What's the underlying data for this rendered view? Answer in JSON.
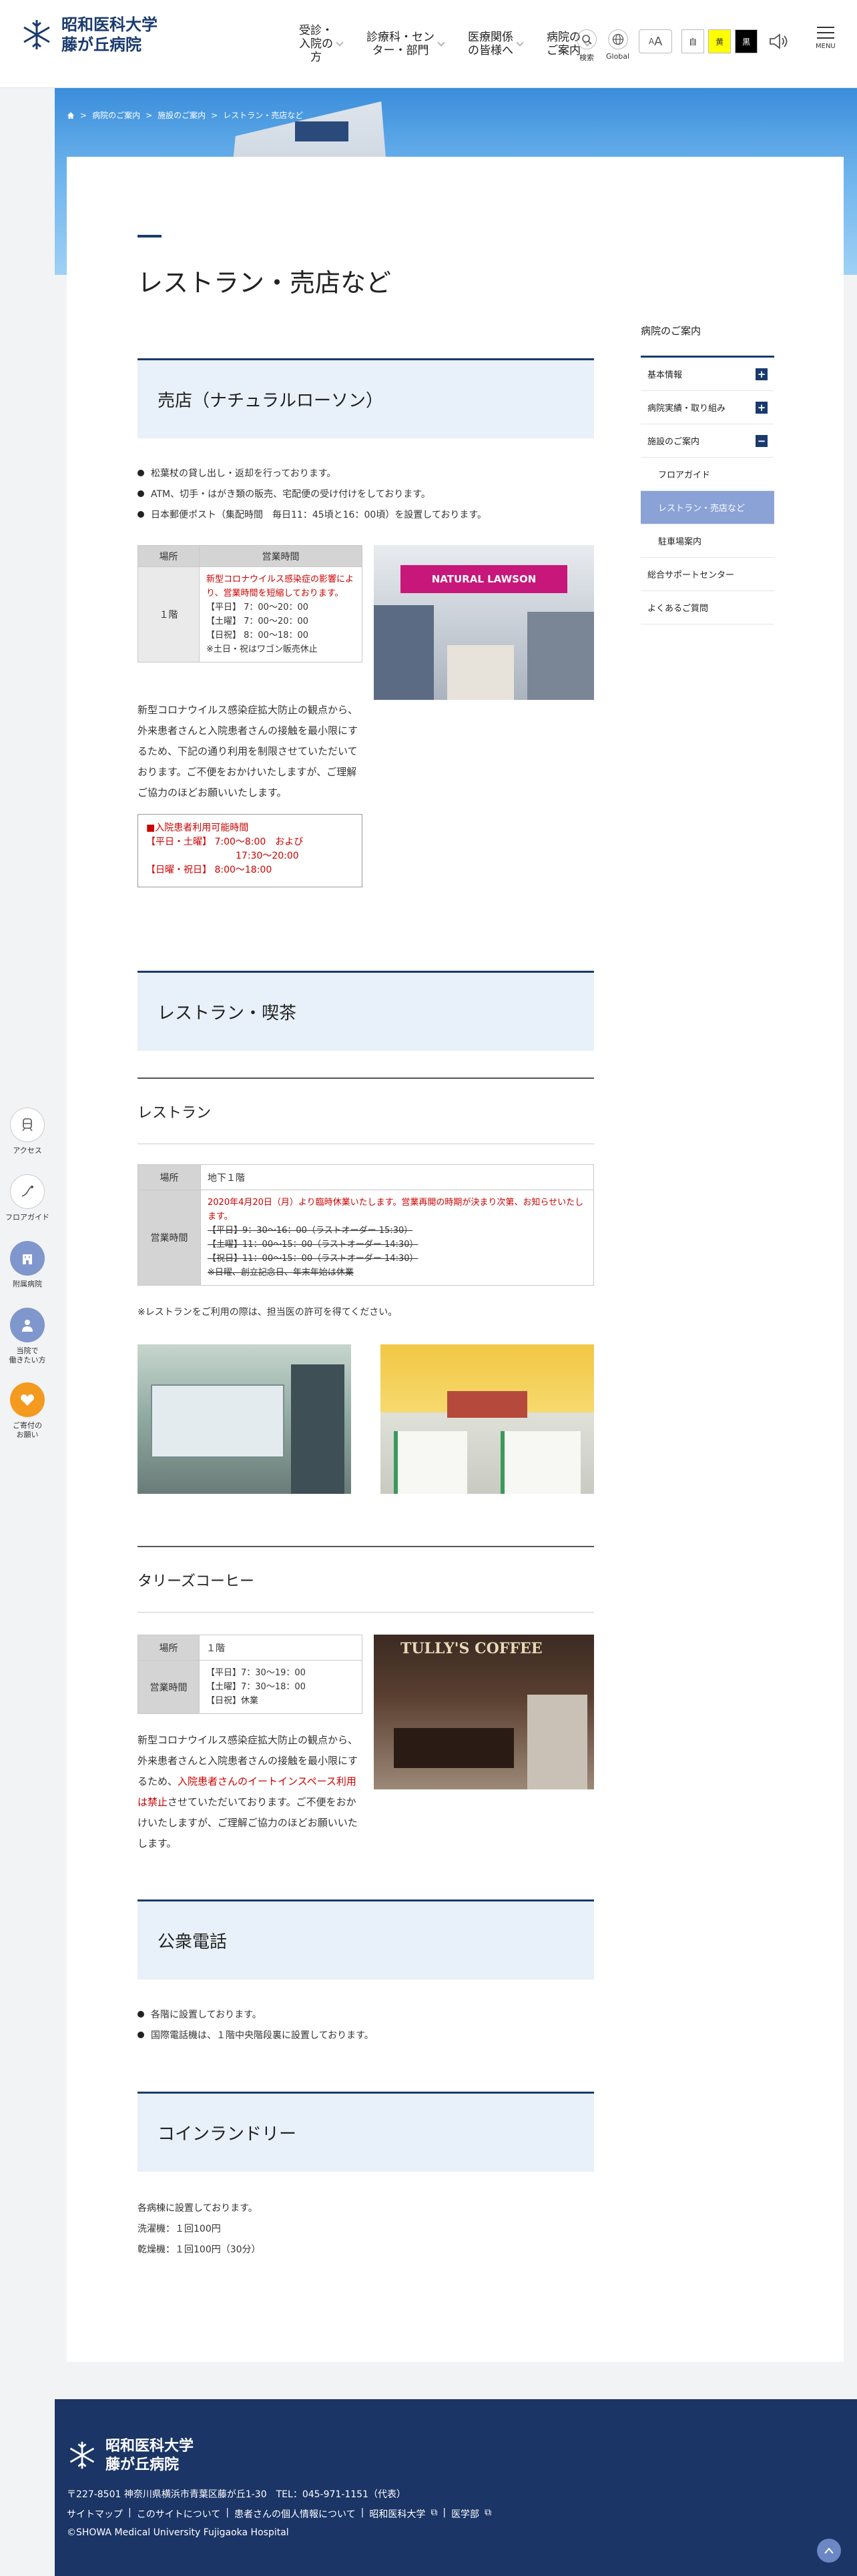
{
  "header": {
    "logo_line1": "昭和医科大学",
    "logo_line2": "藤が丘病院",
    "nav": [
      "受診・\n入院の\n方",
      "診療科・セン\nター・部門",
      "医療関係\nの皆様へ",
      "病院の\nご案内"
    ],
    "search_label": "検索",
    "global_label": "Global",
    "font_label": "A",
    "color_std": "自",
    "color_yellow": "黄",
    "color_black": "黒",
    "menu_label": "MENU"
  },
  "breadcrumb": [
    "病院のご案内",
    "施設のご案内",
    "レストラン・売店など"
  ],
  "page": {
    "title": "レストラン・売店など"
  },
  "store": {
    "heading": "売店（ナチュラルローソン）",
    "bullets": [
      "松葉杖の貸し出し・返却を行っております。",
      "ATM、切手・はがき類の販売、宅配便の受け付けをしております。",
      "日本郵便ポスト（集配時間　毎日11：45頃と16：00頃）を設置しております。"
    ],
    "th_place": "場所",
    "th_hours": "営業時間",
    "place": "１階",
    "hours_notice": "新型コロナウイルス感染症の影響により、営業時間を短縮しております。",
    "hours": [
      "【平日】 7：00〜20：00",
      "【土曜】 7：00〜20：00",
      "【日祝】 8：00〜18：00",
      "※土日・祝はワゴン販売休止"
    ],
    "photo_sign": "NATURAL LAWSON",
    "paragraph": "新型コロナウイルス感染症拡大防止の観点から、外来患者さんと入院患者さんの接触を最小限にするため、下記の通り利用を制限させていただいております。ご不便をおかけいたしますが、ご理解ご協力のほどお願いいたします。",
    "notice_title": "■入院患者利用可能時間",
    "notice_lines": [
      "【平日・土曜】 7:00〜8:00　および",
      "17:30〜20:00",
      "【日曜・祝日】 8:00〜18:00"
    ]
  },
  "restaurant": {
    "heading": "レストラン・喫茶",
    "sub1": "レストラン",
    "th_place": "場所",
    "place": "地下１階",
    "th_hours": "営業時間",
    "notice": "2020年4月20日（月）より臨時休業いたします。営業再開の時期が決まり次第、お知らせいたします。",
    "old_hours": [
      "【平日】9：30〜16：00（ラストオーダー 15:30）",
      "【土曜】11：00〜15：00（ラストオーダー 14:30）",
      "【祝日】11：00〜15：00（ラストオーダー 14:30）",
      "※日曜、創立記念日、年末年始は休業"
    ],
    "note": "※レストランをご利用の際は、担当医の許可を得てください。",
    "sub2": "タリーズコーヒー",
    "t_place": "１階",
    "t_hours": [
      "【平日】7：30〜19：00",
      "【土曜】7：30〜18：00",
      "【日祝】休業"
    ],
    "th_hours2": "営業時間",
    "tully_sign": "TULLY'S COFFEE",
    "tully_para_1": "新型コロナウイルス感染症拡大防止の観点から、外来患者さんと入院患者さんの接触を最小限にするため、",
    "tully_para_red": "入院患者さんのイートインスペース利用は禁止",
    "tully_para_2": "させていただいております。ご不便をおかけいたしますが、ご理解ご協力のほどお願いいたします。"
  },
  "phone": {
    "heading": "公衆電話",
    "bullets": [
      "各階に設置しております。",
      "国際電話機は、１階中央階段裏に設置しております。"
    ]
  },
  "laundry": {
    "heading": "コインランドリー",
    "lines": [
      "各病棟に設置しております。",
      "洗濯機：１回100円",
      "乾燥機：１回100円（30分）"
    ]
  },
  "sidebar": {
    "title": "病院のご案内",
    "items": [
      "基本情報",
      "病院実績・取り組み",
      "施設のご案内",
      "フロアガイド",
      "レストラン・売店など",
      "駐車場案内",
      "総合サポートセンター",
      "よくあるご質問"
    ]
  },
  "leftbar": [
    "アクセス",
    "フロアガイド",
    "附属病院",
    "当院で\n働きたい方",
    "ご寄付の\nお願い"
  ],
  "footer": {
    "name1": "昭和医科大学",
    "name2": "藤が丘病院",
    "address": "〒227-8501 神奈川県横浜市青葉区藤が丘1-30　TEL：045-971-1151（代表）",
    "links": [
      "サイトマップ",
      "このサイトについて",
      "患者さんの個人情報について",
      "昭和医科大学",
      "医学部"
    ],
    "copyright": "©SHOWA Medical University Fujigaoka Hospital"
  },
  "colors": {
    "navy": "#1a3a6e",
    "red": "#cc0000",
    "light_blue": "#e8f1f9",
    "active": "#8aa2d6",
    "footer": "#1b3566"
  }
}
